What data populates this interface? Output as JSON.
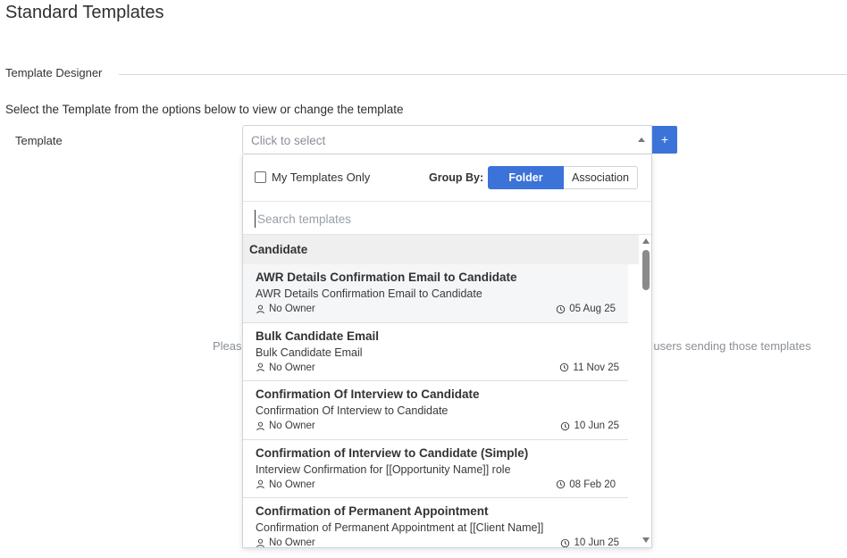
{
  "page": {
    "title": "Standard Templates",
    "section_label": "Template Designer",
    "instructions": "Select the Template from the options below to view or change the template",
    "background_message_left": "Pleas",
    "background_message_right": "ll users sending those templates"
  },
  "template_field": {
    "label": "Template",
    "placeholder": "Click to select",
    "add_button_label": "+"
  },
  "dropdown": {
    "my_templates_only_label": "My Templates Only",
    "my_templates_only_checked": false,
    "group_by_label": "Group By:",
    "group_by_options": [
      "Folder",
      "Association"
    ],
    "group_by_selected": "Folder",
    "search_placeholder": "Search templates",
    "group_name": "Candidate",
    "items": [
      {
        "title": "AWR Details Confirmation Email to Candidate",
        "description": "AWR Details Confirmation Email to Candidate",
        "owner": "No Owner",
        "date": "05 Aug 25"
      },
      {
        "title": "Bulk Candidate Email",
        "description": "Bulk Candidate Email",
        "owner": "No Owner",
        "date": "11 Nov 25"
      },
      {
        "title": "Confirmation Of Interview to Candidate",
        "description": "Confirmation Of Interview to Candidate",
        "owner": "No Owner",
        "date": "10 Jun 25"
      },
      {
        "title": "Confirmation of Interview to Candidate (Simple)",
        "description": "Interview Confirmation for [[Opportunity Name]] role",
        "owner": "No Owner",
        "date": "08 Feb 20"
      },
      {
        "title": "Confirmation of Permanent Appointment",
        "description": "Confirmation of Permanent Appointment at [[Client Name]]",
        "owner": "No Owner",
        "date": "10 Jun 25"
      }
    ]
  },
  "colors": {
    "accent": "#3b73d9",
    "group_header_bg": "#efefef",
    "selected_item_bg": "#f5f6f8"
  },
  "icons": {
    "owner": "person-icon",
    "date": "clock-icon"
  }
}
